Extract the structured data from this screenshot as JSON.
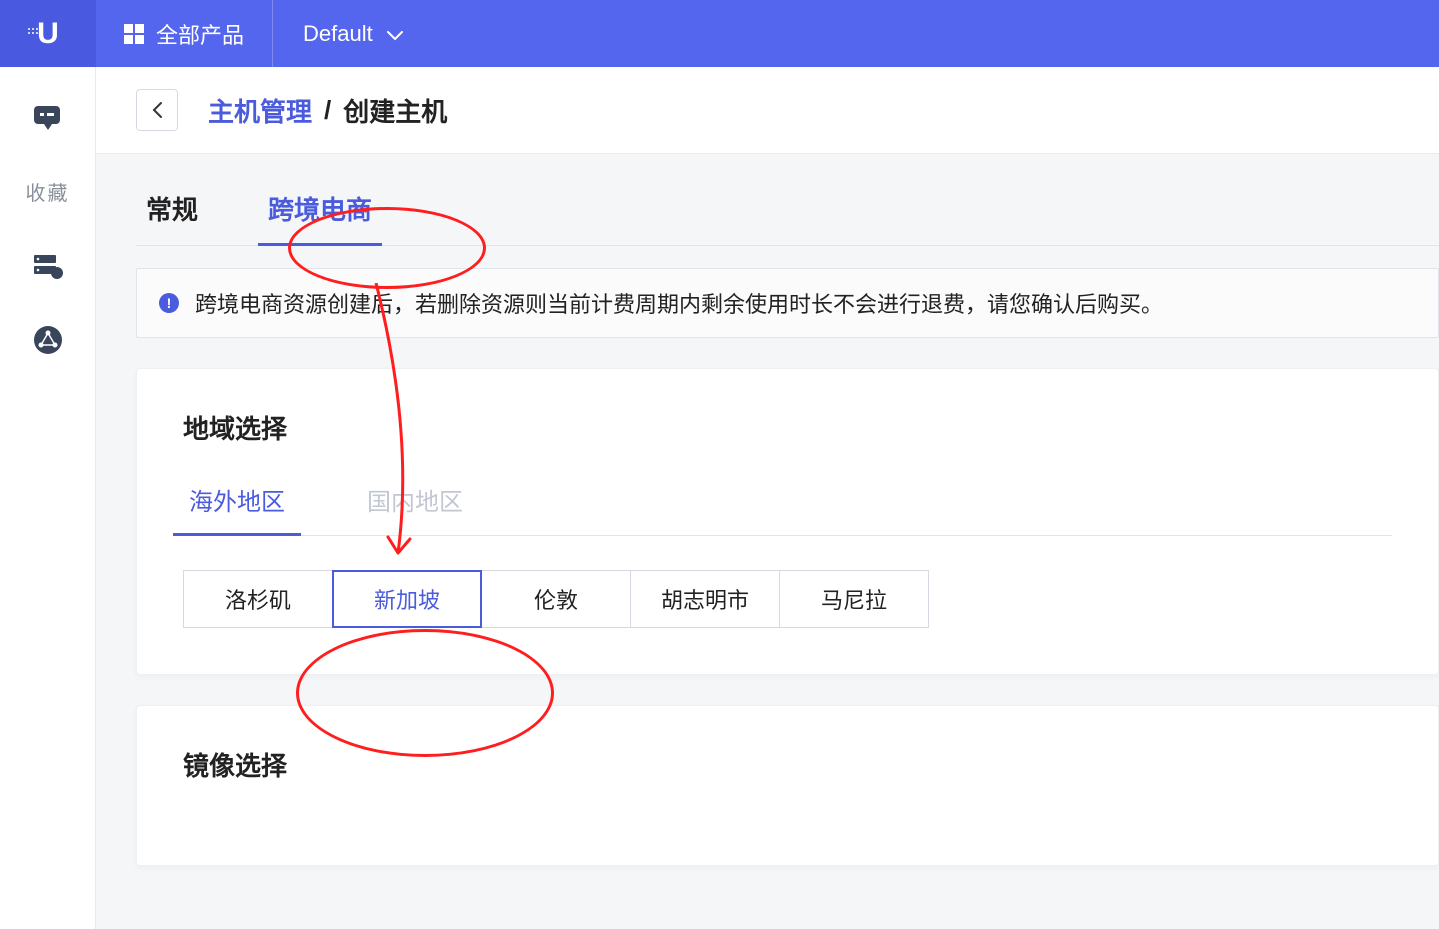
{
  "header": {
    "all_products_label": "全部产品",
    "project_name": "Default"
  },
  "sidebar": {
    "favorites_label": "收藏"
  },
  "breadcrumb": {
    "link": "主机管理",
    "separator": "/",
    "current": "创建主机"
  },
  "tabs": {
    "normal": "常规",
    "ecommerce": "跨境电商"
  },
  "alert": {
    "text": "跨境电商资源创建后，若删除资源则当前计费周期内剩余使用时长不会进行退费，请您确认后购买。"
  },
  "region_panel": {
    "title": "地域选择",
    "subtabs": {
      "overseas": "海外地区",
      "domestic": "国内地区"
    },
    "regions": [
      "洛杉矶",
      "新加坡",
      "伦敦",
      "胡志明市",
      "马尼拉"
    ],
    "selected_index": 1
  },
  "image_panel": {
    "title": "镜像选择"
  }
}
